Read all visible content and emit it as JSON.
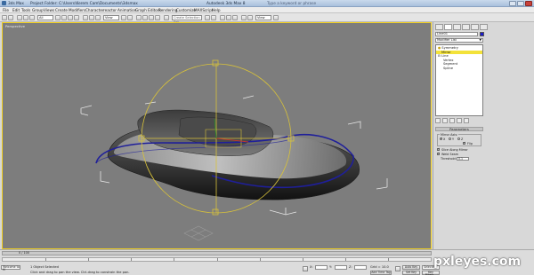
{
  "titlebar": {
    "app": "3ds Max",
    "project": "Project Folder: C:\\Users\\Kerem Cam\\Documents\\3dsmax",
    "title": "Autodesk 3ds Max 8",
    "search_hint": "Type a keyword or phrase"
  },
  "menubar": {
    "items": [
      "File",
      "Edit",
      "Tools",
      "Group",
      "Views",
      "Create",
      "Modifiers",
      "Character",
      "reactor",
      "Animation",
      "Graph Editors",
      "Rendering",
      "Customize",
      "MAXScript",
      "Help"
    ]
  },
  "toolbar": {
    "selection_filter": "All",
    "ref_coord": "View",
    "named_selection": "Create Selection Set",
    "render_type": "View"
  },
  "viewport": {
    "label": "Perspective",
    "gizmo_color": "#d8c23a",
    "spline_color": "#1f1f9a"
  },
  "command_panel": {
    "object_name": "Line01",
    "object_color": "#1c1ccc",
    "modifier_list": "Modifier List",
    "stack": [
      {
        "label": "Symmetry",
        "selected": false
      },
      {
        "label": "Mirror",
        "selected": true
      },
      {
        "label": "Line",
        "selected": false
      },
      {
        "label": "Vertex",
        "selected": false
      },
      {
        "label": "Segment",
        "selected": false
      },
      {
        "label": "Spline",
        "selected": false
      }
    ],
    "params_title": "Parameters",
    "mirror_axis_label": "Mirror Axis:",
    "axis_x": "X",
    "axis_y": "Y",
    "axis_z": "Z",
    "flip_label": "Flip",
    "slice_label": "Slice Along Mirror",
    "weld_label": "Weld Seam",
    "threshold_label": "Threshold:",
    "threshold_value": "0.1"
  },
  "timeline": {
    "frame_readout": "0 / 100",
    "ticks": [
      "0",
      "10",
      "20",
      "30",
      "40",
      "50",
      "60",
      "70",
      "80",
      "90",
      "100"
    ]
  },
  "status": {
    "maxscript": "Welcome to M",
    "selected": "1 Object Selected",
    "prompt": "Click and drag to pan the view. Ctrl-drag to constrain the pan.",
    "x_label": "X:",
    "y_label": "Y:",
    "z_label": "Z:",
    "grid": "Grid = 10.0",
    "auto_key": "Auto Key",
    "selected_btn": "Selected",
    "set_key": "Set Key",
    "key_filters": "Key Filters...",
    "add_time_tag": "Add Time Tag"
  },
  "watermark": "pxleyes.com"
}
